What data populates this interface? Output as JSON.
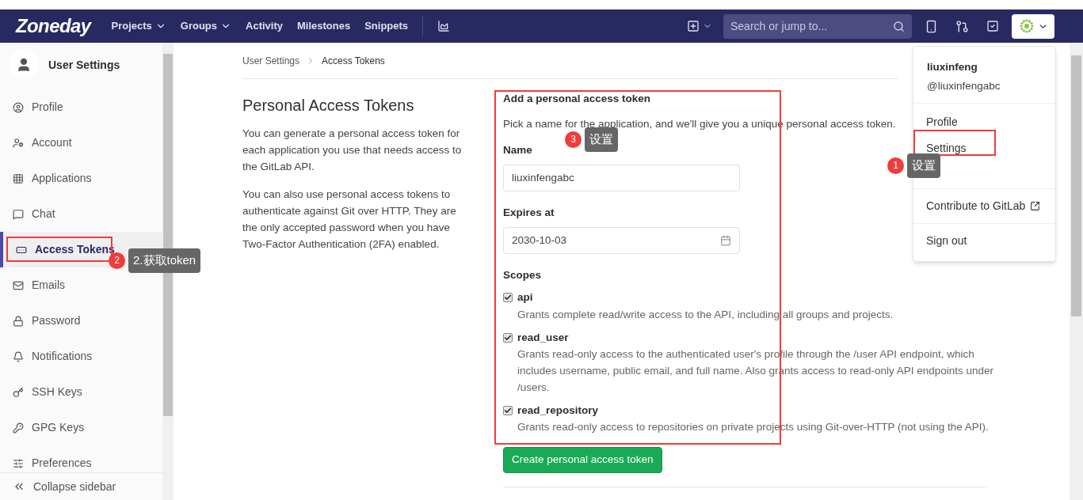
{
  "navbar": {
    "logo": "Zoneday",
    "links": [
      {
        "label": "Projects",
        "dropdown": true
      },
      {
        "label": "Groups",
        "dropdown": true
      },
      {
        "label": "Activity",
        "dropdown": false
      },
      {
        "label": "Milestones",
        "dropdown": false
      },
      {
        "label": "Snippets",
        "dropdown": false
      }
    ],
    "search": {
      "placeholder": "Search or jump to..."
    }
  },
  "sidebar": {
    "title": "User Settings",
    "items": [
      {
        "label": "Profile",
        "selected": false
      },
      {
        "label": "Account",
        "selected": false
      },
      {
        "label": "Applications",
        "selected": false
      },
      {
        "label": "Chat",
        "selected": false
      },
      {
        "label": "Access Tokens",
        "selected": true
      },
      {
        "label": "Emails",
        "selected": false
      },
      {
        "label": "Password",
        "selected": false
      },
      {
        "label": "Notifications",
        "selected": false
      },
      {
        "label": "SSH Keys",
        "selected": false
      },
      {
        "label": "GPG Keys",
        "selected": false
      },
      {
        "label": "Preferences",
        "selected": false
      }
    ],
    "collapse": "Collapse sidebar"
  },
  "breadcrumb": [
    "User Settings",
    "Access Tokens"
  ],
  "intro": {
    "title": "Personal Access Tokens",
    "paragraphs": [
      "You can generate a personal access token for each application you use that needs access to the GitLab API.",
      "You can also use personal access tokens to authenticate against Git over HTTP. They are the only accepted password when you have Two-Factor Authentication (2FA) enabled."
    ]
  },
  "form": {
    "heading": "Add a personal access token",
    "hint": "Pick a name for the application, and we'll give you a unique personal access token.",
    "name_label": "Name",
    "name_value": "liuxinfengabc",
    "expires_label": "Expires at",
    "expires_value": "2030-10-03",
    "scopes_label": "Scopes",
    "scopes": [
      {
        "name": "api",
        "checked": true,
        "description": "Grants complete read/write access to the API, including all groups and projects."
      },
      {
        "name": "read_user",
        "checked": true,
        "description": "Grants read-only access to the authenticated user's profile through the /user API endpoint, which includes username, public email, and full name. Also grants access to read-only API endpoints under /users."
      },
      {
        "name": "read_repository",
        "checked": true,
        "description": "Grants read-only access to repositories on private projects using Git-over-HTTP (not using the API)."
      }
    ],
    "submit": "Create personal access token"
  },
  "user_menu": {
    "name": "liuxinfeng",
    "handle": "@liuxinfengabc",
    "items": [
      {
        "label": "Profile",
        "external": false
      },
      {
        "label": "Settings",
        "external": false
      },
      {
        "label": "Contribute to GitLab",
        "external": true
      },
      {
        "label": "Sign out",
        "external": false
      }
    ]
  },
  "annotations": [
    {
      "number": "1",
      "label": "设置"
    },
    {
      "number": "2",
      "label": "2.获取token"
    },
    {
      "number": "3",
      "label": "设置"
    }
  ]
}
